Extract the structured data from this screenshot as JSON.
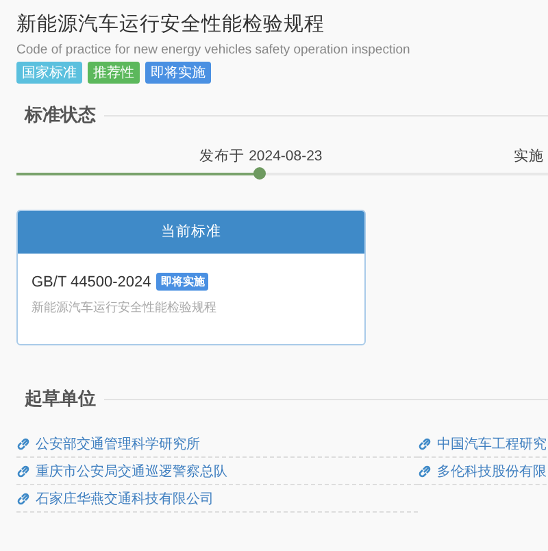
{
  "title": "新能源汽车运行安全性能检验规程",
  "subtitle": "Code of practice for new energy vehicles safety operation inspection",
  "tags": [
    {
      "label": "国家标准",
      "color": "#5bc0de"
    },
    {
      "label": "推荐性",
      "color": "#5cb85c"
    },
    {
      "label": "即将实施",
      "color": "#4a90e2"
    }
  ],
  "status": {
    "heading": "标准状态",
    "level": 0.46,
    "events": [
      "发布于 2024-08-23",
      "实施"
    ]
  },
  "current": {
    "header": "当前标准",
    "code": "GB/T 44500-2024",
    "badge": "即将实施",
    "name": "新能源汽车运行安全性能检验规程"
  },
  "drafters": {
    "heading": "起草单位",
    "items": [
      "公安部交通管理科学研究所",
      "中国汽车工程研究",
      "重庆市公安局交通巡逻警察总队",
      "多伦科技股份有限",
      "石家庄华燕交通科技有限公司"
    ]
  }
}
